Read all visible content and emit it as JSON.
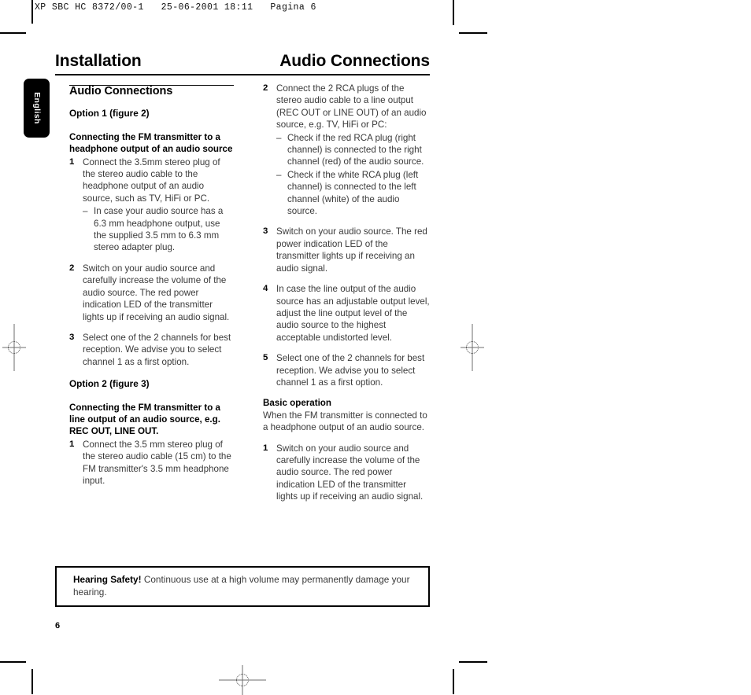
{
  "printer_slug": "XP SBC HC 8372/00-1   25-06-2001 18:11   Pagina 6",
  "language_tab": "English",
  "titles": {
    "left": "Installation",
    "right": "Audio Connections"
  },
  "page_number": "6",
  "left_column": {
    "section_heading": "Audio Connections",
    "option1_label": "Option 1 (figure 2)",
    "option1_subhead": "Connecting the FM transmitter to a headphone output of an audio source",
    "option1_steps": [
      {
        "num": "1",
        "text": "Connect the 3.5mm stereo plug of the stereo audio cable to the headphone output of an audio source, such as TV, HiFi or PC.",
        "sub": [
          "In case your audio source has a 6.3 mm headphone output, use the supplied 3.5 mm to 6.3 mm stereo adapter plug."
        ]
      },
      {
        "num": "2",
        "text": "Switch on your audio source and carefully increase the volume of the audio source. The red power indication LED of the transmitter lights up if receiving an audio signal.",
        "sub": []
      },
      {
        "num": "3",
        "text": "Select one of the 2 channels for best reception. We advise you to select channel 1 as a first option.",
        "sub": []
      }
    ],
    "option2_label": "Option 2 (figure 3)",
    "option2_subhead": "Connecting the FM transmitter to a line output of an audio source, e.g. REC OUT, LINE OUT.",
    "option2_steps": [
      {
        "num": "1",
        "text": "Connect the 3.5 mm stereo plug of the stereo audio cable (15 cm) to the FM transmitter's 3.5 mm headphone input.",
        "sub": []
      }
    ]
  },
  "right_column": {
    "steps": [
      {
        "num": "2",
        "text": "Connect the 2 RCA plugs of the stereo audio cable to a line output (REC OUT or LINE OUT) of an audio source, e.g. TV, HiFi or PC:",
        "sub": [
          "Check if the red RCA plug (right channel) is connected to the right channel (red) of the audio source.",
          "Check if the white RCA plug (left channel) is connected to the left channel (white) of the audio source."
        ]
      },
      {
        "num": "3",
        "text": "Switch on your audio source. The red power indication LED of the transmitter lights up if receiving an audio signal.",
        "sub": []
      },
      {
        "num": "4",
        "text": "In case the line output of the audio source has an adjustable output level, adjust the line output level of the audio source to the highest acceptable undistorted level.",
        "sub": []
      },
      {
        "num": "5",
        "text": "Select one of the 2 channels for best reception. We advise you to select channel 1 as a first option.",
        "sub": []
      }
    ],
    "basic_operation_heading": "Basic operation",
    "basic_operation_intro": "When the FM transmitter is connected to a headphone output of an audio source.",
    "basic_operation_steps": [
      {
        "num": "1",
        "text": "Switch on your audio source and carefully increase the volume of the audio source. The red power indication LED of the transmitter lights up if receiving an audio signal.",
        "sub": []
      }
    ]
  },
  "warning": {
    "bold_lead": "Hearing Safety!",
    "body": " Continuous use at a high volume may permanently damage your hearing."
  }
}
